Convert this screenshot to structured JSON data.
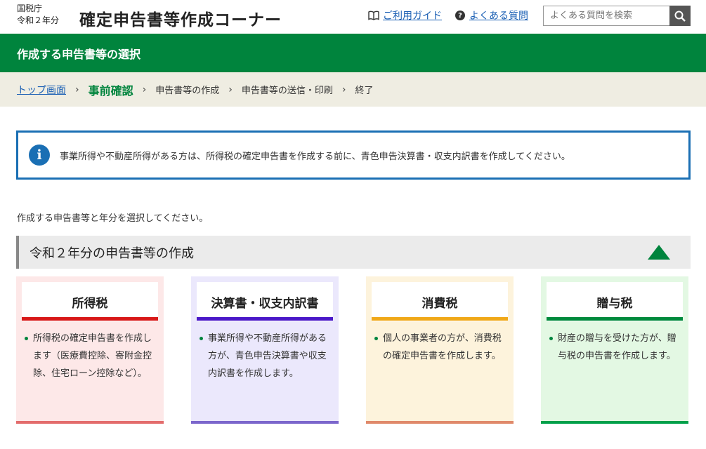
{
  "header": {
    "agency_line1": "国税庁",
    "agency_line2": "令和２年分",
    "title": "確定申告書等作成コーナー",
    "guide_label": "ご利用ガイド",
    "faq_label": "よくある質問",
    "search_placeholder": "よくある質問を検索"
  },
  "page_title": "作成する申告書等の選択",
  "steps": {
    "top": "トップ画面",
    "current": "事前確認",
    "step3": "申告書等の作成",
    "step4": "申告書等の送信・印刷",
    "step5": "終了"
  },
  "info": {
    "text": "事業所得や不動産所得がある方は、所得税の確定申告書を作成する前に、青色申告決算書・収支内訳書を作成してください。"
  },
  "instruction": "作成する申告書等と年分を選択してください。",
  "section": {
    "title": "令和２年分の申告書等の作成"
  },
  "cards": [
    {
      "title": "所得税",
      "desc": "所得税の確定申告書を作成します（医療費控除、寄附金控除、住宅ローン控除など）。",
      "bg": "#fde8e8",
      "bar": "#d81818",
      "bottom": "#e36c6c"
    },
    {
      "title": "決算書・収支内訳書",
      "desc": "事業所得や不動産所得がある方が、青色申告決算書や収支内訳書を作成します。",
      "bg": "#ebe8fc",
      "bar": "#4a18c8",
      "bottom": "#7b66cc"
    },
    {
      "title": "消費税",
      "desc": "個人の事業者の方が、消費税の確定申告書を作成します。",
      "bg": "#fdf3dc",
      "bar": "#f0a818",
      "bottom": "#e0896a"
    },
    {
      "title": "贈与税",
      "desc": "財産の贈与を受けた方が、贈与税の申告書を作成します。",
      "bg": "#e3f8e3",
      "bar": "#008a3c",
      "bottom": "#00a04a"
    }
  ],
  "colors": {
    "brand_green": "#00843d",
    "info_blue": "#1a6fb4",
    "link_blue": "#1a5fb4"
  },
  "icons": {
    "guide": "book-icon",
    "faq": "question-circle-icon",
    "search": "magnifier-icon",
    "info": "info-circle-icon",
    "collapse": "triangle-up-icon"
  }
}
